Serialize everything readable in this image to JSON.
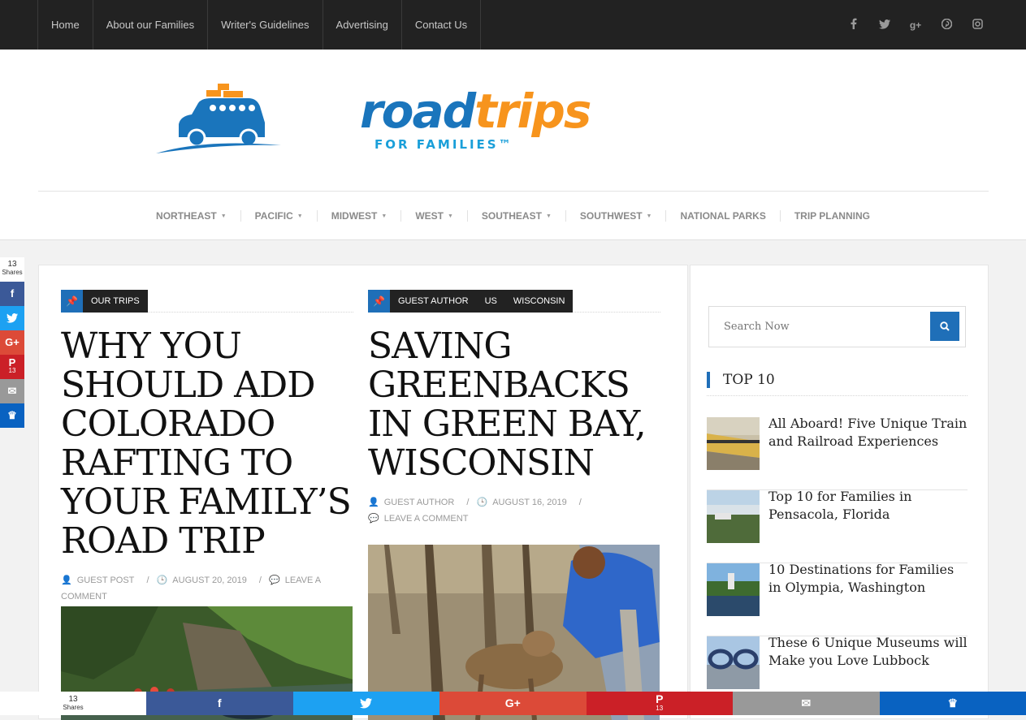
{
  "topnav": {
    "items": [
      "Home",
      "About our Families",
      "Writer's Guidelines",
      "Advertising",
      "Contact Us"
    ],
    "social": [
      "facebook-icon",
      "twitter-icon",
      "google-plus-icon",
      "pinterest-icon",
      "instagram-icon"
    ]
  },
  "logo": {
    "road": "road",
    "trips": "trips",
    "sub": "FOR FAMILIES™",
    "colors": {
      "blue": "#1a75bc",
      "orange": "#f7941d"
    }
  },
  "catnav": [
    "NORTHEAST",
    "PACIFIC",
    "MIDWEST",
    "WEST",
    "SOUTHEAST",
    "SOUTHWEST",
    "NATIONAL PARKS",
    "TRIP PLANNING"
  ],
  "posts": [
    {
      "categories": [
        "OUR TRIPS"
      ],
      "title": "WHY YOU SHOULD ADD COLORADO RAFTING TO YOUR FAMILY’S ROAD TRIP",
      "author": "GUEST POST",
      "date": "AUGUST 20, 2019",
      "comment": "LEAVE A COMMENT"
    },
    {
      "categories": [
        "GUEST AUTHOR",
        "US",
        "WISCONSIN"
      ],
      "title": "SAVING GREENBACKS IN GREEN BAY, WISCONSIN",
      "author": "GUEST AUTHOR",
      "date": "AUGUST 16, 2019",
      "comment": "LEAVE A COMMENT"
    }
  ],
  "sidebar": {
    "search_placeholder": "Search Now",
    "widget_title": "TOP 10",
    "items": [
      "All Aboard! Five Unique Train and Railroad Experiences",
      "Top 10 for Families in Pensacola, Florida",
      "10 Destinations for Families in Olympia, Washington",
      "These 6 Unique Museums will Make you Love Lubbock"
    ]
  },
  "share": {
    "count": "13",
    "label": "Shares",
    "pinterest_count": "13"
  },
  "colors": {
    "accent": "#1f6fb8",
    "dark": "#222222"
  }
}
